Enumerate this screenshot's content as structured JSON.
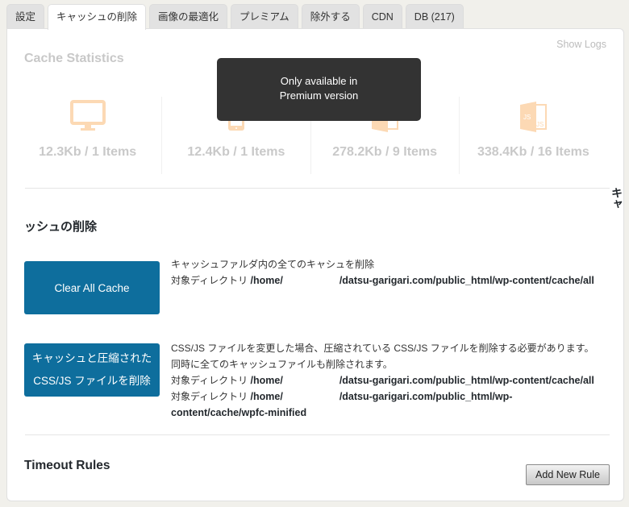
{
  "tabs": [
    {
      "label": "設定",
      "active": false
    },
    {
      "label": "キャッシュの削除",
      "active": true
    },
    {
      "label": "画像の最適化",
      "active": false
    },
    {
      "label": "プレミアム",
      "active": false
    },
    {
      "label": "除外する",
      "active": false
    },
    {
      "label": "CDN",
      "active": false
    },
    {
      "label": "DB (217)",
      "active": false
    }
  ],
  "stats": {
    "title": "Cache Statistics",
    "show_logs": "Show Logs",
    "items": [
      {
        "icon": "desktop-icon",
        "value": "12.3Kb / 1 Items"
      },
      {
        "icon": "mobile-icon",
        "value": "12.4Kb / 1 Items"
      },
      {
        "icon": "css-file-icon",
        "value": "278.2Kb / 9 Items"
      },
      {
        "icon": "js-file-icon",
        "value": "338.4Kb / 16 Items"
      }
    ],
    "tooltip_line1": "Only available in",
    "tooltip_line2": "Premium version",
    "accent_color": "#fcd9b4"
  },
  "delete_section": {
    "title": "ッシュの削除",
    "overflow_text": "キャ",
    "clear_all": {
      "button": "Clear All Cache",
      "desc_line1": "キャッシュファルダ内の全てのキャシュを削除",
      "dir_label": "対象ディレクトリ",
      "dir_path_start": "/home/",
      "dir_path_end": "/datsu-garigari.com/public_html/wp-content/cache/all"
    },
    "clear_minified": {
      "button_line1": "キャッシュと圧縮された",
      "button_line2": "CSS/JS ファイルを削除",
      "desc_line1": "CSS/JS ファイルを変更した場合、圧縮されている CSS/JS ファイルを削除する必要があります。",
      "desc_line2": "同時に全てのキャッシュファイルも削除されます。",
      "dir1_label": "対象ディレクトリ",
      "dir1_start": "/home/",
      "dir1_end": "/datsu-garigari.com/public_html/wp-content/cache/all",
      "dir2_label": "対象ディレクトリ",
      "dir2_start": "/home/",
      "dir2_end": "/datsu-garigari.com/public_html/wp-",
      "dir2_cont": "content/cache/wpfc-minified"
    },
    "button_color": "#0e6e9d"
  },
  "timeout": {
    "title": "Timeout Rules",
    "add_button": "Add New Rule"
  }
}
